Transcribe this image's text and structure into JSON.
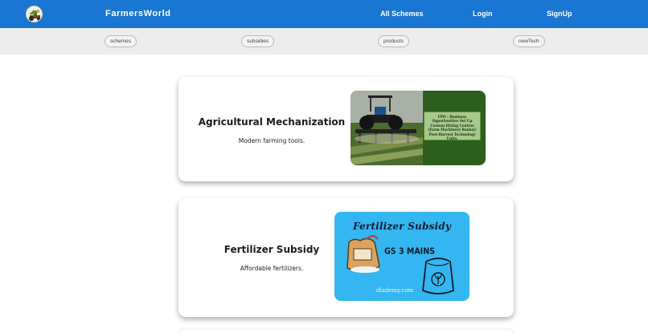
{
  "navbar": {
    "logo_icon": "farm-logo-icon",
    "brand": "FarmersWorld",
    "links": [
      "All Schemes",
      "Login",
      "SignUp"
    ],
    "background": "#1976d2"
  },
  "categories": [
    "schemes",
    "subsidies",
    "products",
    "newTech"
  ],
  "cards": [
    {
      "title": "Agricultural Mechanization",
      "description": "Modern farming tools.",
      "image": {
        "icon": "tractor-photo",
        "panel_text": "FPO - Business Opportunities Set Up Custom Hiring Centres (Farm Machinery Banks)/ Post-Harvest Technology Units."
      }
    },
    {
      "title": "Fertilizer Subsidy",
      "description": "Affordable fertilizers.",
      "image": {
        "icon": "fertilizer-bags",
        "heading": "Fertilizer Subsidy",
        "tag": "GS 3 MAINS",
        "site": "diademy.com",
        "background": "#34b6f1"
      }
    }
  ]
}
